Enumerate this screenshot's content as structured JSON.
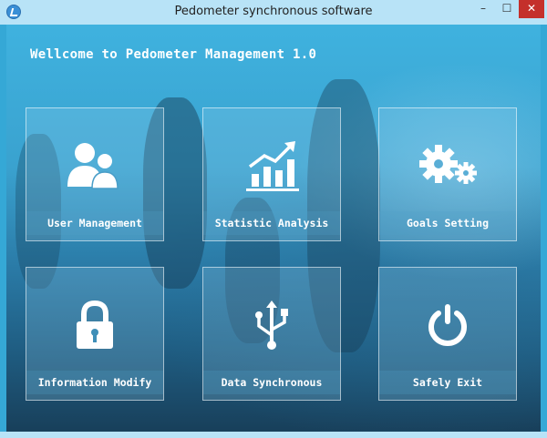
{
  "window": {
    "title": "Pedometer synchronous software",
    "minimize": "–",
    "maximize": "☐",
    "close": "✕"
  },
  "app": {
    "headline": "Wellcome to Pedometer Management 1.0"
  },
  "tiles": [
    {
      "label": "User Management",
      "icon": "users-icon"
    },
    {
      "label": "Statistic Analysis",
      "icon": "bar-chart-icon"
    },
    {
      "label": "Goals Setting",
      "icon": "gears-icon"
    },
    {
      "label": "Information Modify",
      "icon": "lock-icon"
    },
    {
      "label": "Data Synchronous",
      "icon": "usb-icon"
    },
    {
      "label": "Safely Exit",
      "icon": "power-icon"
    }
  ],
  "colors": {
    "titlebar": "#b8e3f7",
    "close_button": "#c4302b",
    "tile_icon": "#ffffff"
  }
}
